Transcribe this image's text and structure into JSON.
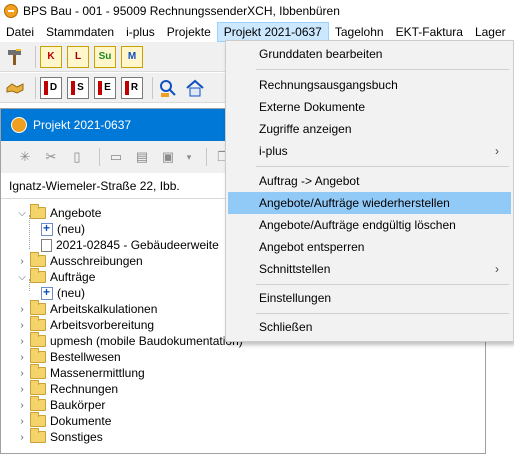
{
  "window": {
    "title": "BPS Bau - 001 - 95009 RechnungssenderXCH, Ibbenbüren"
  },
  "menubar": {
    "items": [
      {
        "label": "Datei",
        "key": "datei"
      },
      {
        "label": "Stammdaten",
        "key": "stammdaten"
      },
      {
        "label": "i-plus",
        "key": "iplus"
      },
      {
        "label": "Projekte",
        "key": "projekte"
      },
      {
        "label": "Projekt 2021-0637",
        "key": "projekt",
        "active": true
      },
      {
        "label": "Tagelohn",
        "key": "tagelohn"
      },
      {
        "label": "EKT-Faktura",
        "key": "ekt"
      },
      {
        "label": "Lager",
        "key": "lager"
      }
    ]
  },
  "toolbar": {
    "row1": [
      {
        "icon": "hammer-icon"
      },
      {
        "icon": "document-k-icon",
        "letter": "K"
      },
      {
        "icon": "document-l-icon",
        "letter": "L"
      },
      {
        "icon": "document-su-icon",
        "letter": "Su"
      },
      {
        "icon": "document-m-icon",
        "letter": "M"
      }
    ],
    "row2": [
      {
        "icon": "handshake-icon"
      },
      {
        "icon": "report-d-icon",
        "letter": "D"
      },
      {
        "icon": "report-s-icon",
        "letter": "S"
      },
      {
        "icon": "report-e-icon",
        "letter": "E"
      },
      {
        "icon": "report-r-icon",
        "letter": "R"
      },
      {
        "icon": "search-people-icon"
      },
      {
        "icon": "house-icon"
      }
    ]
  },
  "panel": {
    "title": "Projekt 2021-0637",
    "address": "Ignatz-Wiemeler-Straße 22, Ibb.",
    "tree": [
      {
        "label": "Angebote",
        "level": 0,
        "expanded": true,
        "type": "folder"
      },
      {
        "label": "(neu)",
        "level": 1,
        "type": "new"
      },
      {
        "label": "2021-02845 - Gebäudeerweite",
        "level": 1,
        "type": "doc"
      },
      {
        "label": "Ausschreibungen",
        "level": 0,
        "expanded": false,
        "type": "folder"
      },
      {
        "label": "Aufträge",
        "level": 0,
        "expanded": true,
        "type": "folder"
      },
      {
        "label": "(neu)",
        "level": 1,
        "type": "new"
      },
      {
        "label": "Arbeitskalkulationen",
        "level": 0,
        "expanded": false,
        "type": "folder"
      },
      {
        "label": "Arbeitsvorbereitung",
        "level": 0,
        "expanded": false,
        "type": "folder"
      },
      {
        "label": "upmesh (mobile Baudokumentation)",
        "level": 0,
        "expanded": false,
        "type": "folder"
      },
      {
        "label": "Bestellwesen",
        "level": 0,
        "expanded": false,
        "type": "folder"
      },
      {
        "label": "Massenermittlung",
        "level": 0,
        "expanded": false,
        "type": "folder"
      },
      {
        "label": "Rechnungen",
        "level": 0,
        "expanded": false,
        "type": "folder"
      },
      {
        "label": "Baukörper",
        "level": 0,
        "expanded": false,
        "type": "folder"
      },
      {
        "label": "Dokumente",
        "level": 0,
        "expanded": false,
        "type": "folder"
      },
      {
        "label": "Sonstiges",
        "level": 0,
        "expanded": false,
        "type": "folder"
      }
    ]
  },
  "dropdown": {
    "items": [
      {
        "label": "Grunddaten bearbeiten",
        "key": "grunddaten"
      },
      {
        "sep": true
      },
      {
        "label": "Rechnungsausgangsbuch",
        "key": "rechnungsausgangsbuch"
      },
      {
        "label": "Externe Dokumente",
        "key": "externe-dokumente"
      },
      {
        "label": "Zugriffe anzeigen",
        "key": "zugriffe"
      },
      {
        "label": "i-plus",
        "key": "iplus",
        "submenu": true
      },
      {
        "sep": true
      },
      {
        "label": "Auftrag -> Angebot",
        "key": "auftrag-angebot"
      },
      {
        "label": "Angebote/Aufträge wiederherstellen",
        "key": "wiederherstellen",
        "highlighted": true
      },
      {
        "label": "Angebote/Aufträge endgültig löschen",
        "key": "loeschen"
      },
      {
        "label": "Angebot entsperren",
        "key": "entsperren"
      },
      {
        "label": "Schnittstellen",
        "key": "schnittstellen",
        "submenu": true
      },
      {
        "sep": true
      },
      {
        "label": "Einstellungen",
        "key": "einstellungen"
      },
      {
        "sep": true
      },
      {
        "label": "Schließen",
        "key": "schliessen"
      }
    ]
  }
}
